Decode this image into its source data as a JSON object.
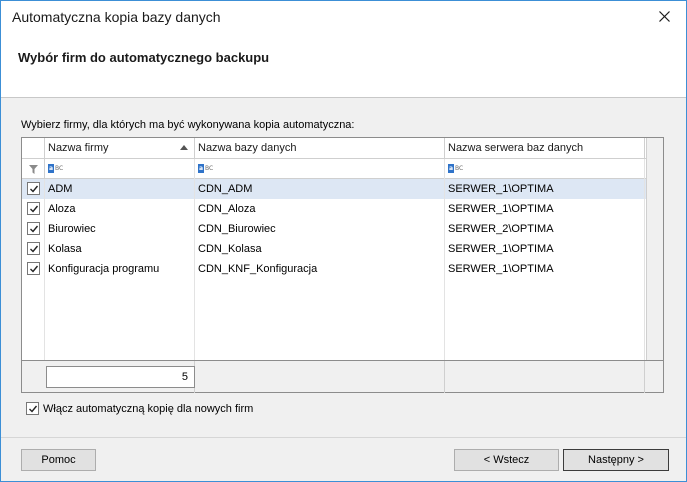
{
  "window": {
    "title": "Automatyczna kopia bazy danych"
  },
  "header": {
    "title": "Wybór firm do automatycznego backupu"
  },
  "instruction": "Wybierz firmy, dla których ma być wykonywana kopia automatyczna:",
  "grid": {
    "columns": [
      "Nazwa firmy",
      "Nazwa bazy danych",
      "Nazwa serwera baz danych"
    ],
    "filter_icon_text": "BC",
    "rows": [
      {
        "checked": true,
        "firm": "ADM",
        "db": "CDN_ADM",
        "server": "SERWER_1\\OPTIMA",
        "selected": true
      },
      {
        "checked": true,
        "firm": "Aloza",
        "db": "CDN_Aloza",
        "server": "SERWER_1\\OPTIMA"
      },
      {
        "checked": true,
        "firm": "Biurowiec",
        "db": "CDN_Biurowiec",
        "server": "SERWER_2\\OPTIMA"
      },
      {
        "checked": true,
        "firm": "Kolasa",
        "db": "CDN_Kolasa",
        "server": "SERWER_1\\OPTIMA"
      },
      {
        "checked": true,
        "firm": "Konfiguracja programu",
        "db": "CDN_KNF_Konfiguracja",
        "server": "SERWER_1\\OPTIMA"
      }
    ],
    "count": "5"
  },
  "auto_backup": {
    "checked": true,
    "label": "Włącz automatyczną kopię dla nowych firm"
  },
  "buttons": {
    "help": "Pomoc",
    "back": "< Wstecz",
    "next": "Następny >"
  },
  "colors": {
    "accent": "#3c8fd6",
    "selected_row": "#dde7f4"
  }
}
